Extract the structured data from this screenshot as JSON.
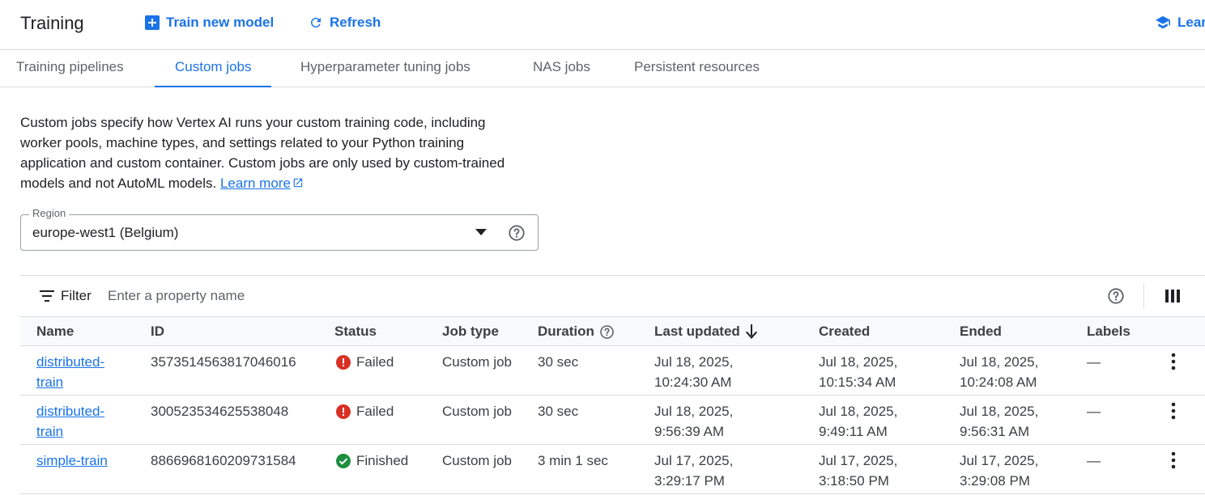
{
  "header": {
    "title": "Training",
    "train_label": "Train new model",
    "refresh_label": "Refresh",
    "learn_label": "Lear",
    "accent_color": "#1a73e8"
  },
  "tabs": [
    {
      "label": "Training pipelines",
      "active": false
    },
    {
      "label": "Custom jobs",
      "active": true
    },
    {
      "label": "Hyperparameter tuning jobs",
      "active": false
    },
    {
      "label": "NAS jobs",
      "active": false
    },
    {
      "label": "Persistent resources",
      "active": false
    }
  ],
  "description": {
    "text": "Custom jobs specify how Vertex AI runs your custom training code, including worker pools, machine types, and settings related to your Python training application and custom container. Custom jobs are only used by custom-trained models and not AutoML models.",
    "link": "Learn more"
  },
  "region": {
    "label": "Region",
    "value": "europe-west1 (Belgium)"
  },
  "filter": {
    "label": "Filter",
    "placeholder": "Enter a property name"
  },
  "table": {
    "columns": [
      "Name",
      "ID",
      "Status",
      "Job type",
      "Duration",
      "Last updated",
      "Created",
      "Ended",
      "Labels"
    ],
    "rows": [
      {
        "name": "distributed-train",
        "id": "3573514563817046016",
        "status": "Failed",
        "job_type": "Custom job",
        "duration": "30 sec",
        "last_updated": "Jul 18, 2025, 10:24:30 AM",
        "created": "Jul 18, 2025, 10:15:34 AM",
        "ended": "Jul 18, 2025, 10:24:08 AM",
        "labels": "—"
      },
      {
        "name": "distributed-train",
        "id": "300523534625538048",
        "status": "Failed",
        "job_type": "Custom job",
        "duration": "30 sec",
        "last_updated": "Jul 18, 2025, 9:56:39 AM",
        "created": "Jul 18, 2025, 9:49:11 AM",
        "ended": "Jul 18, 2025, 9:56:31 AM",
        "labels": "—"
      },
      {
        "name": "simple-train",
        "id": "8866968160209731584",
        "status": "Finished",
        "job_type": "Custom job",
        "duration": "3 min 1 sec",
        "last_updated": "Jul 17, 2025, 3:29:17 PM",
        "created": "Jul 17, 2025, 3:18:50 PM",
        "ended": "Jul 17, 2025, 3:29:08 PM",
        "labels": "—"
      }
    ]
  },
  "status_colors": {
    "Failed": "#d93025",
    "Finished": "#1e8e3e"
  }
}
